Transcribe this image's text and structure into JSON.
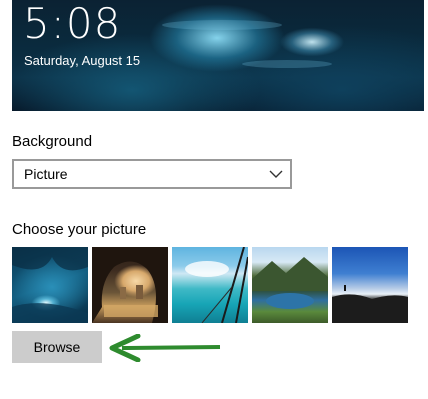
{
  "lockscreen_preview": {
    "time": "5:08",
    "date": "Saturday, August 15"
  },
  "background": {
    "label": "Background",
    "dropdown_value": "Picture",
    "dropdown_icon": "chevron-down-icon"
  },
  "choose_picture": {
    "label": "Choose your picture",
    "thumbnails": [
      {
        "name": "ice-cave"
      },
      {
        "name": "beach-cave-arch"
      },
      {
        "name": "turquoise-sea-sail"
      },
      {
        "name": "mountain-lake"
      },
      {
        "name": "cliff-sky"
      }
    ]
  },
  "browse_button": {
    "label": "Browse"
  },
  "annotation": {
    "arrow_color": "#2e8b2e",
    "arrow_icon": "left-arrow-icon"
  }
}
